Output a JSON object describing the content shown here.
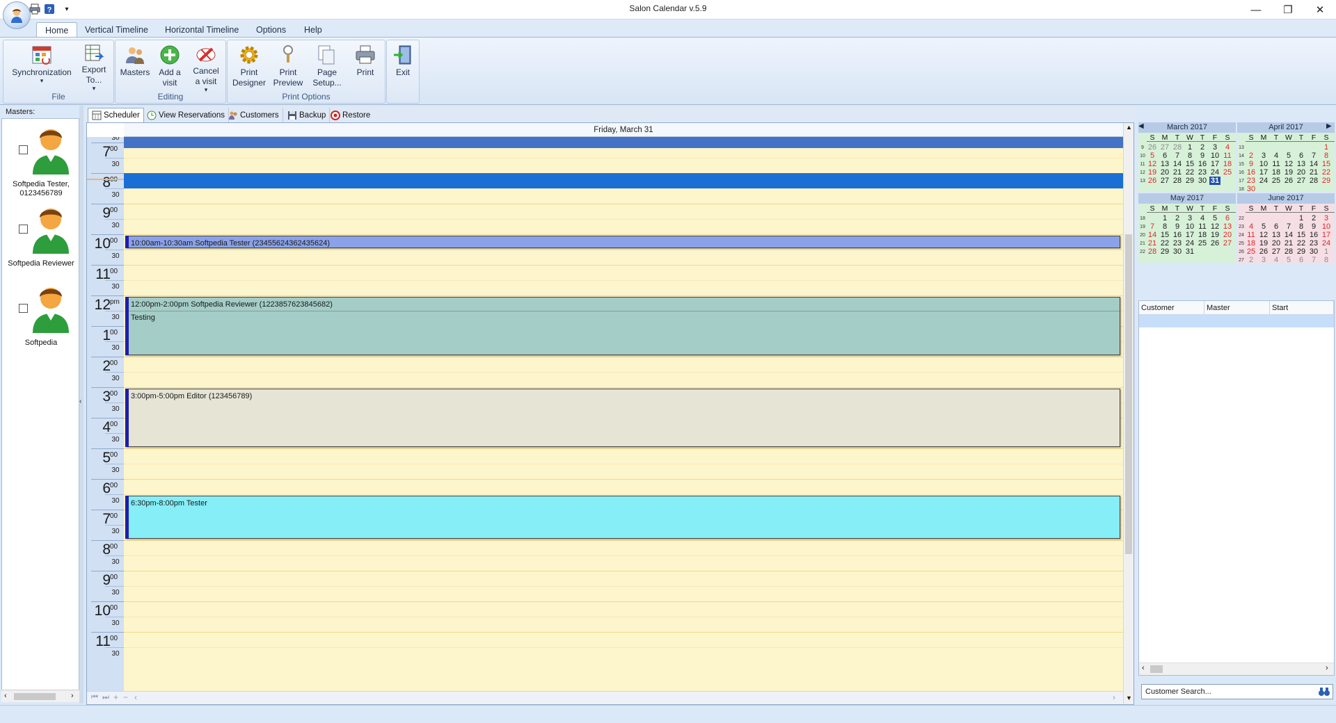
{
  "window": {
    "title": "Salon Calendar v.5.9",
    "minimize": "—",
    "maximize": "❐",
    "close": "✕"
  },
  "quick_access": {
    "print_icon": "print-icon",
    "help_icon": "help-icon",
    "customize": "▾"
  },
  "ribbon_tabs": [
    "Home",
    "Vertical Timeline",
    "Horizontal Timeline",
    "Options",
    "Help"
  ],
  "ribbon": {
    "groups": [
      {
        "label": "File",
        "buttons": [
          {
            "label": "Synchronization",
            "icon": "sync-icon",
            "dropdown": "▾"
          },
          {
            "label": "Export To...",
            "icon": "export-icon",
            "dropdown": "▾"
          }
        ]
      },
      {
        "label": "Editing",
        "buttons": [
          {
            "label": "Masters",
            "icon": "masters-icon"
          },
          {
            "label": "Add a visit",
            "icon": "add-icon"
          },
          {
            "label": "Cancel a visit",
            "icon": "cancel-icon",
            "dropdown": "▾"
          }
        ]
      },
      {
        "label": "Print Options",
        "buttons": [
          {
            "label": "Print Designer",
            "icon": "gear-icon"
          },
          {
            "label": "Print Preview",
            "icon": "preview-icon"
          },
          {
            "label": "Page Setup...",
            "icon": "page-setup-icon"
          },
          {
            "label": "Print",
            "icon": "print-icon"
          }
        ]
      },
      {
        "label": "",
        "buttons": [
          {
            "label": "Exit",
            "icon": "exit-icon"
          }
        ]
      }
    ]
  },
  "masters": {
    "header": "Masters:",
    "items": [
      {
        "name": "Softpedia Tester, 0123456789"
      },
      {
        "name": "Softpedia Reviewer"
      },
      {
        "name": "Softpedia"
      }
    ]
  },
  "content_tabs": [
    {
      "label": "Scheduler",
      "icon": "scheduler-icon"
    },
    {
      "label": "View Reservations",
      "icon": "reservations-icon"
    },
    {
      "label": "Customers",
      "icon": "customers-icon"
    },
    {
      "label": "Backup",
      "icon": "backup-icon"
    },
    {
      "label": "Restore",
      "icon": "restore-icon"
    }
  ],
  "scheduler": {
    "date_header": "Friday, March 31",
    "hours": [
      {
        "h": "7",
        "m": "00"
      },
      {
        "h": "8",
        "m": "00"
      },
      {
        "h": "9",
        "m": "00"
      },
      {
        "h": "10",
        "m": "00"
      },
      {
        "h": "11",
        "m": "00"
      },
      {
        "h": "12",
        "m": "pm"
      },
      {
        "h": "1",
        "m": "00"
      },
      {
        "h": "2",
        "m": "00"
      },
      {
        "h": "3",
        "m": "00"
      },
      {
        "h": "4",
        "m": "00"
      },
      {
        "h": "5",
        "m": "00"
      },
      {
        "h": "6",
        "m": "00"
      },
      {
        "h": "7",
        "m": "00"
      },
      {
        "h": "8",
        "m": "00"
      },
      {
        "h": "9",
        "m": "00"
      },
      {
        "h": "10",
        "m": "00"
      },
      {
        "h": "11",
        "m": "00"
      }
    ],
    "half_label": "30",
    "appointments": [
      {
        "subject": "10:00am-10:30am Softpedia Tester (23455624362435624)",
        "description": "",
        "color": "#8ba2e8"
      },
      {
        "subject": "12:00pm-2:00pm Softpedia Reviewer (1223857623845682)",
        "description": "Testing",
        "color": "#a3cdc6"
      },
      {
        "subject": "3:00pm-5:00pm Editor (123456789)",
        "description": "",
        "color": "#e5e4d5"
      },
      {
        "subject": "6:30pm-8:00pm Tester",
        "description": "",
        "color": "#86eef6"
      }
    ]
  },
  "calendars": [
    {
      "title": "March 2017",
      "weeks": [
        "9",
        "10",
        "11",
        "12",
        "13"
      ],
      "rows": [
        [
          "26",
          "27",
          "28",
          "1",
          "2",
          "3",
          "4"
        ],
        [
          "5",
          "6",
          "7",
          "8",
          "9",
          "10",
          "11"
        ],
        [
          "12",
          "13",
          "14",
          "15",
          "16",
          "17",
          "18"
        ],
        [
          "19",
          "20",
          "21",
          "22",
          "23",
          "24",
          "25"
        ],
        [
          "26",
          "27",
          "28",
          "29",
          "30",
          "31",
          ""
        ]
      ],
      "selected": "31"
    },
    {
      "title": "April 2017",
      "weeks": [
        "13",
        "14",
        "15",
        "16",
        "17",
        "18"
      ],
      "rows": [
        [
          "",
          "",
          "",
          "",
          "",
          "",
          "1"
        ],
        [
          "2",
          "3",
          "4",
          "5",
          "6",
          "7",
          "8"
        ],
        [
          "9",
          "10",
          "11",
          "12",
          "13",
          "14",
          "15"
        ],
        [
          "16",
          "17",
          "18",
          "19",
          "20",
          "21",
          "22"
        ],
        [
          "23",
          "24",
          "25",
          "26",
          "27",
          "28",
          "29"
        ],
        [
          "30",
          "",
          "",
          "",
          "",
          "",
          ""
        ]
      ]
    },
    {
      "title": "May 2017",
      "weeks": [
        "18",
        "19",
        "20",
        "21",
        "22"
      ],
      "rows": [
        [
          "",
          "1",
          "2",
          "3",
          "4",
          "5",
          "6"
        ],
        [
          "7",
          "8",
          "9",
          "10",
          "11",
          "12",
          "13"
        ],
        [
          "14",
          "15",
          "16",
          "17",
          "18",
          "19",
          "20"
        ],
        [
          "21",
          "22",
          "23",
          "24",
          "25",
          "26",
          "27"
        ],
        [
          "28",
          "29",
          "30",
          "31",
          "",
          "",
          ""
        ]
      ]
    },
    {
      "title": "June 2017",
      "weeks": [
        "22",
        "23",
        "24",
        "25",
        "26",
        "27"
      ],
      "rows": [
        [
          "",
          "",
          "",
          "",
          "1",
          "2",
          "3"
        ],
        [
          "4",
          "5",
          "6",
          "7",
          "8",
          "9",
          "10"
        ],
        [
          "11",
          "12",
          "13",
          "14",
          "15",
          "16",
          "17"
        ],
        [
          "18",
          "19",
          "20",
          "21",
          "22",
          "23",
          "24"
        ],
        [
          "25",
          "26",
          "27",
          "28",
          "29",
          "30",
          "1"
        ],
        [
          "2",
          "3",
          "4",
          "5",
          "6",
          "7",
          "8"
        ]
      ]
    }
  ],
  "dow": [
    "S",
    "M",
    "T",
    "W",
    "T",
    "F",
    "S"
  ],
  "customer_grid": {
    "columns": [
      "Customer",
      "Master",
      "Start"
    ]
  },
  "customer_search": {
    "placeholder": "Customer Search..."
  },
  "colors": {
    "accent": "#4472c4",
    "now_bar": "#1a6fd4",
    "work_hours": "#fdf5cc",
    "ruler": "#d1e0f3",
    "weekend": "#e32424"
  }
}
